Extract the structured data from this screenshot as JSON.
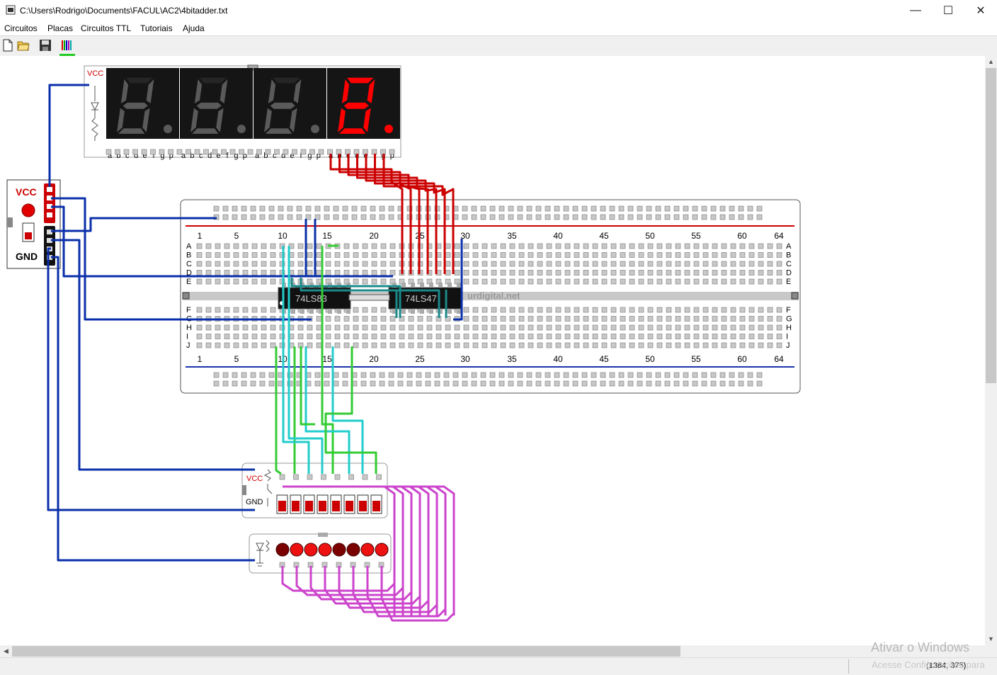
{
  "window": {
    "title": "C:\\Users\\Rodrigo\\Documents\\FACUL\\AC2\\4bitadder.txt",
    "minimize_glyph": "—",
    "maximize_glyph": "☐",
    "close_glyph": "✕"
  },
  "menu": [
    "Circuitos",
    "Placas",
    "Circuitos TTL",
    "Tutoriais",
    "Ajuda"
  ],
  "toolbar": {
    "icons": [
      "new-file-icon",
      "open-folder-icon",
      "save-icon",
      "wire-colors-icon"
    ]
  },
  "display": {
    "vcc_label": "VCC",
    "segment_labels": [
      "a",
      "b",
      "c",
      "d",
      "e",
      "f",
      "g",
      "p"
    ],
    "digits": [
      {
        "segments": "bcdefg",
        "lit": false
      },
      {
        "segments": "bcdefg",
        "lit": false
      },
      {
        "segments": "bcdefg",
        "lit": false
      },
      {
        "segments": "abcdefg",
        "lit": true
      }
    ]
  },
  "power": {
    "vcc_label": "VCC",
    "gnd_label": "GND"
  },
  "breadboard": {
    "column_numbers": [
      "1",
      "5",
      "10",
      "15",
      "20",
      "25",
      "30",
      "35",
      "40",
      "45",
      "50",
      "55",
      "60",
      "64"
    ],
    "rows_top": [
      "A",
      "B",
      "C",
      "D",
      "E"
    ],
    "rows_bottom": [
      "F",
      "G",
      "H",
      "I",
      "J"
    ],
    "chips": [
      "74LS83",
      "74LS47"
    ],
    "watermark": "urdigital.net"
  },
  "switches": {
    "vcc_label": "VCC",
    "gnd_label": "GND",
    "count": 8
  },
  "leds": {
    "states": [
      0,
      1,
      1,
      1,
      0,
      0,
      1,
      1
    ]
  },
  "status": {
    "coordinates": "(1384, 375)"
  },
  "watermark": {
    "line1": "Ativar o Windows",
    "line2": "Acesse Configurações para"
  },
  "colors": {
    "wire_blue": "#0a2faa",
    "wire_red": "#cc0000",
    "wire_green": "#33cc33",
    "wire_cyan": "#22cccc",
    "wire_teal": "#1a8a8a",
    "wire_pink": "#cc44cc",
    "segment_on": "#ff0000",
    "segment_off": "#5a5a5a"
  }
}
